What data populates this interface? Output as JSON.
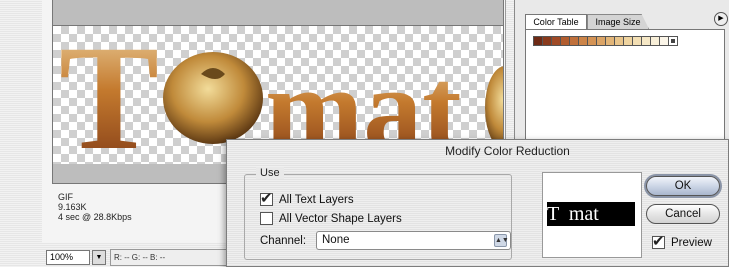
{
  "document": {
    "info": {
      "format": "GIF",
      "size": "9.163K",
      "download": "4 sec @ 28.8Kbps"
    },
    "artwork_text": "Tomat"
  },
  "status_bar": {
    "zoom": "100%",
    "readout": "R:   --  G:   --  B:   --"
  },
  "palette": {
    "tabs": [
      "Color Table",
      "Image Size"
    ],
    "swatches": [
      "#6e2a15",
      "#8a3a1c",
      "#a04a26",
      "#b25d2f",
      "#c0703b",
      "#cc8448",
      "#d49355",
      "#dba466",
      "#e2b578",
      "#e9c58b",
      "#efd4a0",
      "#f3dfb4",
      "#f6e8c6",
      "#f8efd8",
      "#fbf5e8"
    ]
  },
  "dialog": {
    "title": "Modify Color Reduction",
    "group_label": "Use",
    "options": [
      {
        "label": "All Text Layers",
        "checked": true
      },
      {
        "label": "All Vector Shape Layers",
        "checked": false
      }
    ],
    "channel_label": "Channel:",
    "channel_value": "None",
    "preview_text": "T  mat",
    "ok_label": "OK",
    "cancel_label": "Cancel",
    "preview_label": "Preview",
    "preview_checked": true
  }
}
